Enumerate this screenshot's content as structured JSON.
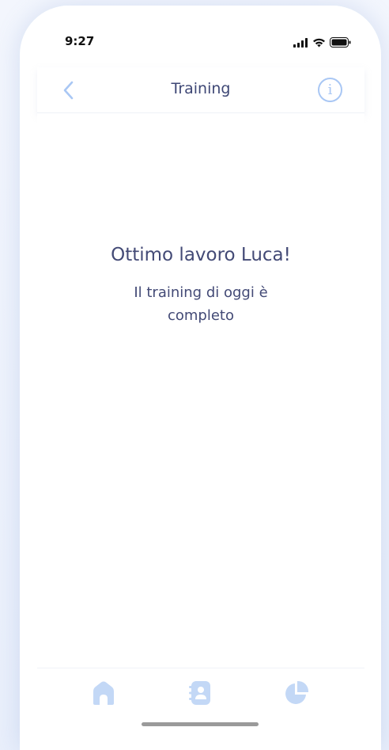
{
  "status_bar": {
    "time": "9:27"
  },
  "header": {
    "title": "Training",
    "back_icon": "chevron-left-icon",
    "info_icon": "info-icon",
    "info_glyph": "i"
  },
  "message": {
    "title": "Ottimo lavoro Luca!",
    "subtitle": "Il training di oggi è completo"
  },
  "tabbar": {
    "items": [
      {
        "icon": "home-icon"
      },
      {
        "icon": "contacts-book-icon"
      },
      {
        "icon": "pie-chart-icon"
      }
    ]
  },
  "colors": {
    "accent": "#a9c7f4",
    "text": "#434a76",
    "background": "#eef3fc"
  }
}
